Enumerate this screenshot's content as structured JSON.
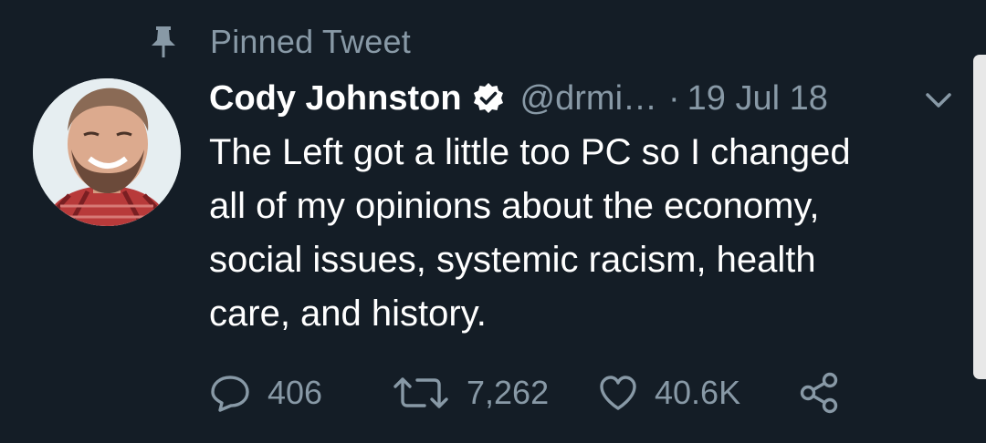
{
  "pinned": {
    "icon": "pin-icon",
    "label": "Pinned Tweet"
  },
  "author": {
    "name": "Cody Johnston",
    "verified_icon": "verified-badge-icon",
    "handle": "@drmi…",
    "separator": "·",
    "date": "19 Jul 18"
  },
  "tweet": {
    "lines": [
      "The Left got a little too PC so I changed",
      "all of my opinions about the economy,",
      "social issues, systemic racism, health",
      "care, and history."
    ]
  },
  "actions": {
    "reply": {
      "icon": "reply-icon",
      "count": "406"
    },
    "retweet": {
      "icon": "retweet-icon",
      "count": "7,262"
    },
    "like": {
      "icon": "heart-icon",
      "count": "40.6K"
    },
    "share": {
      "icon": "share-icon"
    }
  },
  "colors": {
    "background": "#141d26",
    "muted": "#8899a6",
    "text": "#ffffff"
  }
}
